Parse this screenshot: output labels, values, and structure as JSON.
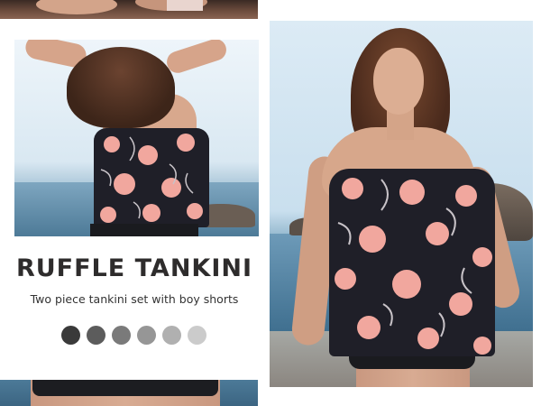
{
  "product": {
    "title": "RUFFLE TANKINI",
    "subtitle": "Two piece tankini set with boy shorts"
  },
  "photos": {
    "top_crop": "partial photo of model",
    "back_view": "back view photo",
    "bottom_crop": "partial photo of shorts",
    "front_view": "front view photo"
  },
  "colors": {
    "print_base": "#1f1f28",
    "flower": "#f1a79e",
    "leaf": "#c8c3c8",
    "shorts": "#1a1b1f"
  },
  "swatches": [
    {
      "name": "swatch-1",
      "color": "#3a3a3a"
    },
    {
      "name": "swatch-2",
      "color": "#5c5c5c"
    },
    {
      "name": "swatch-3",
      "color": "#7a7a7a"
    },
    {
      "name": "swatch-4",
      "color": "#969696"
    },
    {
      "name": "swatch-5",
      "color": "#b0b0b0"
    },
    {
      "name": "swatch-6",
      "color": "#cbcbcb"
    }
  ]
}
